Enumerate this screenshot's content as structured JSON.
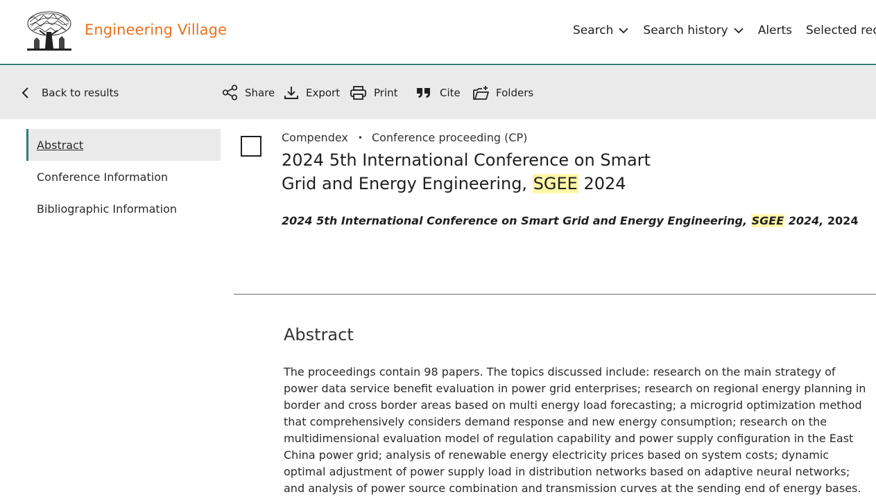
{
  "header": {
    "brand": "Engineering Village",
    "logo_icon": "elsevier-tree-logo",
    "brand_color": "#e9711c",
    "accent_color": "#2e7d74",
    "nav": {
      "search": "Search",
      "search_history": "Search history",
      "alerts": "Alerts",
      "selected_records": "Selected recor"
    }
  },
  "toolbar": {
    "back": "Back to results",
    "share": "Share",
    "export": "Export",
    "print": "Print",
    "cite": "Cite",
    "folders": "Folders"
  },
  "sidebar": {
    "items": [
      {
        "label": "Abstract",
        "active": true
      },
      {
        "label": "Conference Information",
        "active": false
      },
      {
        "label": "Bibliographic Information",
        "active": false
      }
    ]
  },
  "record": {
    "database": "Compendex",
    "doc_type": "Conference proceeding (CP)",
    "title_part1": "2024 5th International Conference on Smart Grid and Energy Engineering, ",
    "title_highlight": "SGEE",
    "title_part2": " 2024",
    "source_part1": "2024 5th International Conference on Smart Grid and Energy Engineering, ",
    "source_highlight": "SGEE",
    "source_part2": " 2024,",
    "source_year": " 2024",
    "highlight_color": "#fff7a8"
  },
  "abstract": {
    "heading": "Abstract",
    "body": "The proceedings contain 98 papers. The topics discussed include: research on the main strategy of power data service benefit evaluation in power grid enterprises; research on regional energy planning in border and cross border areas based on multi energy load forecasting; a microgrid optimization method that comprehensively considers demand response and new energy consumption; research on the multidimensional evaluation model of regulation capability and power supply configuration in the East China power grid; analysis of renewable energy electricity prices based on system costs; dynamic optimal adjustment of power supply load in distribution networks based on adaptive neural networks; and analysis of power source combination and transmission curves at the sending end of energy bases."
  }
}
